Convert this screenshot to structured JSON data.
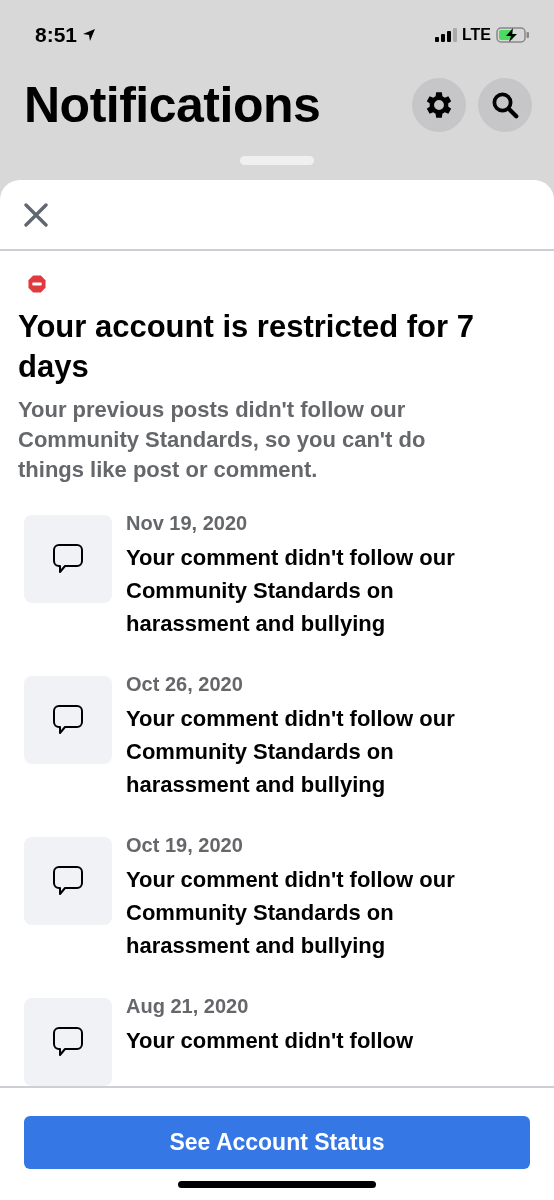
{
  "status_bar": {
    "time": "8:51",
    "network": "LTE"
  },
  "header": {
    "title": "Notifications"
  },
  "sheet": {
    "heading": "Your account is restricted for 7 days",
    "description": "Your previous posts didn't follow our Community Standards, so you can't do things like post or comment.",
    "items": [
      {
        "date": "Nov 19, 2020",
        "text": "Your comment didn't follow our Community Standards on harassment and bullying"
      },
      {
        "date": "Oct 26, 2020",
        "text": "Your comment didn't follow our Community Standards on harassment and bullying"
      },
      {
        "date": "Oct 19, 2020",
        "text": "Your comment didn't follow our Community Standards on harassment and bullying"
      },
      {
        "date": "Aug 21, 2020",
        "text": "Your comment didn't follow"
      }
    ],
    "button": "See Account Status"
  }
}
